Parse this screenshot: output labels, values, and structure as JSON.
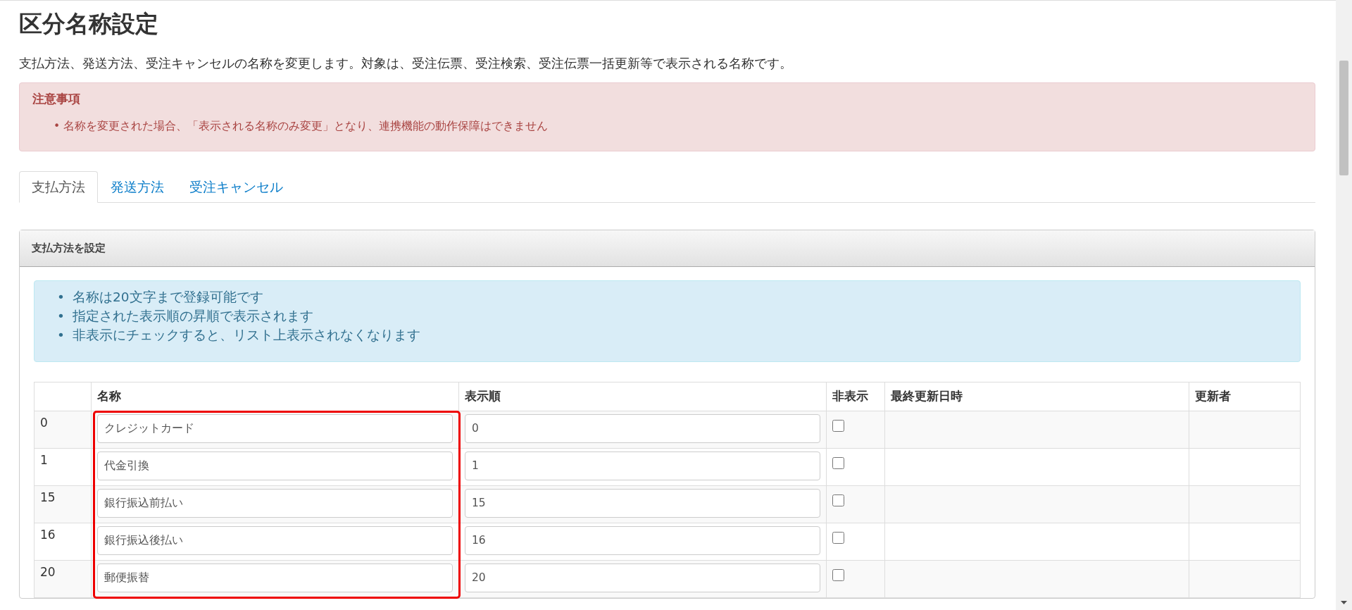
{
  "page": {
    "title": "区分名称設定",
    "description": "支払方法、発送方法、受注キャンセルの名称を変更します。対象は、受注伝票、受注検索、受注伝票一括更新等で表示される名称です。"
  },
  "notice": {
    "heading": "注意事項",
    "items": [
      {
        "marker": "•",
        "text": "名称を変更された場合、「表示される名称のみ変更」となり、連携機能の動作保障はできません"
      }
    ]
  },
  "tabs": [
    {
      "label": "支払方法",
      "selected": true
    },
    {
      "label": "発送方法",
      "selected": false
    },
    {
      "label": "受注キャンセル",
      "selected": false
    }
  ],
  "panel": {
    "title": "支払方法を設定",
    "info_items": [
      {
        "marker": "•",
        "text": "名称は20文字まで登録可能です"
      },
      {
        "marker": "•",
        "text": "指定された表示順の昇順で表示されます"
      },
      {
        "marker": "•",
        "text": "非表示にチェックすると、リスト上表示されなくなります"
      }
    ]
  },
  "table": {
    "columns": [
      "名称",
      "表示順",
      "非表示",
      "最終更新日時",
      "更新者"
    ],
    "rows": [
      {
        "id": "0",
        "name": "クレジットカード",
        "order": "0",
        "hidden": false
      },
      {
        "id": "1",
        "name": "代金引換",
        "order": "1",
        "hidden": false
      },
      {
        "id": "15",
        "name": "銀行振込前払い",
        "order": "15",
        "hidden": false
      },
      {
        "id": "16",
        "name": "銀行振込後払い",
        "order": "16",
        "hidden": false
      },
      {
        "id": "20",
        "name": "郵便振替",
        "order": "20",
        "hidden": false
      }
    ]
  }
}
